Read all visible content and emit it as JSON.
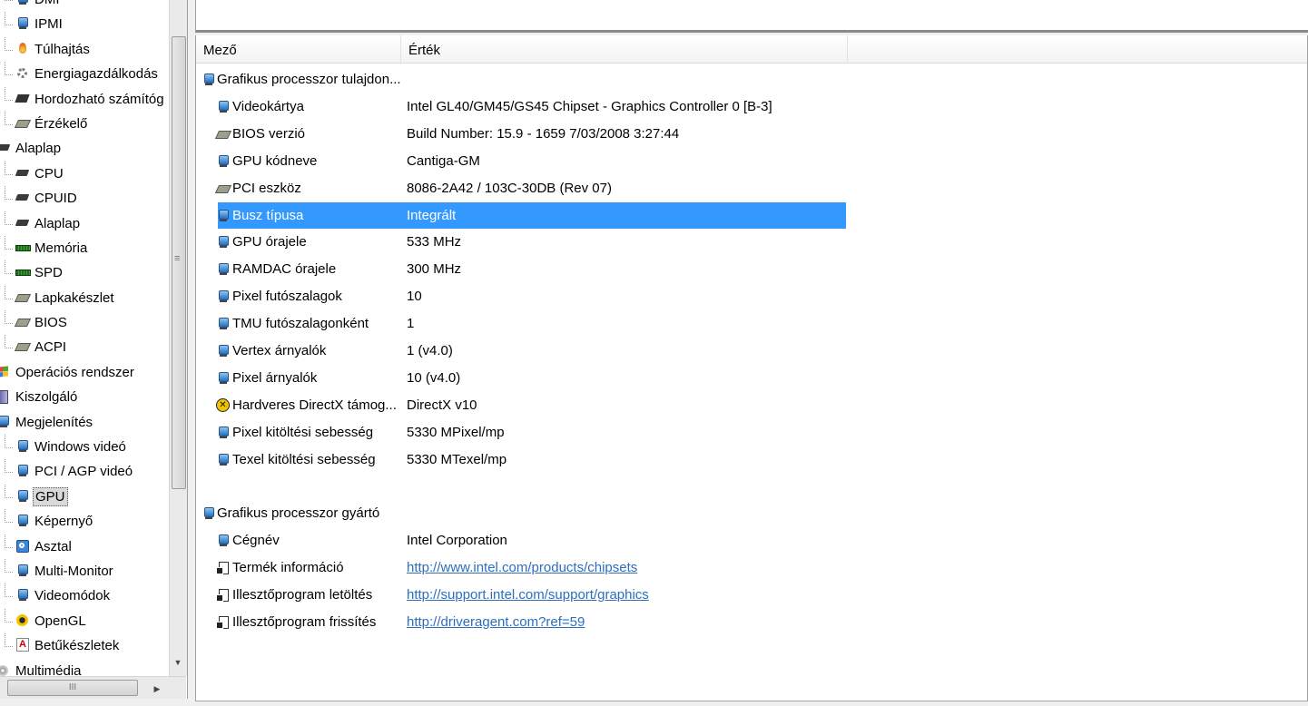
{
  "tree": {
    "items": [
      {
        "label": "DMI",
        "level": 2,
        "icon": "monitor-icon"
      },
      {
        "label": "IPMI",
        "level": 2,
        "icon": "monitor-icon"
      },
      {
        "label": "Túlhajtás",
        "level": 2,
        "icon": "fire-icon"
      },
      {
        "label": "Energiagazdálkodás",
        "level": 2,
        "icon": "gear-icon"
      },
      {
        "label": "Hordozható számítóg",
        "level": 2,
        "icon": "laptop-icon"
      },
      {
        "label": "Érzékelő",
        "level": 2,
        "icon": "card-icon"
      },
      {
        "label": "Alaplap",
        "level": 1,
        "icon": "chip-icon"
      },
      {
        "label": "CPU",
        "level": 2,
        "icon": "chip-icon"
      },
      {
        "label": "CPUID",
        "level": 2,
        "icon": "chip-icon"
      },
      {
        "label": "Alaplap",
        "level": 2,
        "icon": "chip-icon"
      },
      {
        "label": "Memória",
        "level": 2,
        "icon": "ram-icon"
      },
      {
        "label": "SPD",
        "level": 2,
        "icon": "ram-icon"
      },
      {
        "label": "Lapkakészlet",
        "level": 2,
        "icon": "card-icon"
      },
      {
        "label": "BIOS",
        "level": 2,
        "icon": "card-icon"
      },
      {
        "label": "ACPI",
        "level": 2,
        "icon": "card-icon"
      },
      {
        "label": "Operációs rendszer",
        "level": 1,
        "icon": "windows-icon"
      },
      {
        "label": "Kiszolgáló",
        "level": 1,
        "icon": "server-icon"
      },
      {
        "label": "Megjelenítés",
        "level": 1,
        "icon": "monitor-icon"
      },
      {
        "label": "Windows videó",
        "level": 2,
        "icon": "monitor-icon"
      },
      {
        "label": "PCI / AGP videó",
        "level": 2,
        "icon": "monitor-icon"
      },
      {
        "label": "GPU",
        "level": 2,
        "icon": "monitor-icon",
        "selected": true
      },
      {
        "label": "Képernyő",
        "level": 2,
        "icon": "monitor-icon"
      },
      {
        "label": "Asztal",
        "level": 2,
        "icon": "desktop-icon"
      },
      {
        "label": "Multi-Monitor",
        "level": 2,
        "icon": "monitor-icon"
      },
      {
        "label": "Videomódok",
        "level": 2,
        "icon": "monitor-icon"
      },
      {
        "label": "OpenGL",
        "level": 2,
        "icon": "opengl-icon"
      },
      {
        "label": "Betűkészletek",
        "level": 2,
        "icon": "font-icon"
      },
      {
        "label": "Multimédia",
        "level": 1,
        "icon": "multimedia-icon"
      }
    ]
  },
  "details": {
    "columns": {
      "field": "Mező",
      "value": "Érték"
    },
    "rows": [
      {
        "kind": "group",
        "field": "Grafikus processzor tulajdon...",
        "value": "",
        "icon": "monitor-icon"
      },
      {
        "kind": "item",
        "field": "Videokártya",
        "value": "Intel GL40/GM45/GS45 Chipset - Graphics Controller 0 [B-3]",
        "icon": "monitor-icon"
      },
      {
        "kind": "item",
        "field": "BIOS verzió",
        "value": "Build Number: 15.9 - 1659  7/03/2008  3:27:44",
        "icon": "card-icon"
      },
      {
        "kind": "item",
        "field": "GPU kódneve",
        "value": "Cantiga-GM",
        "icon": "monitor-icon"
      },
      {
        "kind": "item",
        "field": "PCI eszköz",
        "value": "8086-2A42 / 103C-30DB  (Rev 07)",
        "icon": "card-icon"
      },
      {
        "kind": "item",
        "field": "Busz típusa",
        "value": "Integrált",
        "icon": "monitor-icon",
        "selected": true
      },
      {
        "kind": "item",
        "field": "GPU órajele",
        "value": "533 MHz",
        "icon": "monitor-icon"
      },
      {
        "kind": "item",
        "field": "RAMDAC órajele",
        "value": "300 MHz",
        "icon": "monitor-icon"
      },
      {
        "kind": "item",
        "field": "Pixel futószalagok",
        "value": "10",
        "icon": "monitor-icon"
      },
      {
        "kind": "item",
        "field": "TMU futószalagonként",
        "value": "1",
        "icon": "monitor-icon"
      },
      {
        "kind": "item",
        "field": "Vertex árnyalók",
        "value": "1  (v4.0)",
        "icon": "monitor-icon"
      },
      {
        "kind": "item",
        "field": "Pixel árnyalók",
        "value": "10  (v4.0)",
        "icon": "monitor-icon"
      },
      {
        "kind": "item",
        "field": "Hardveres DirectX támog...",
        "value": "DirectX v10",
        "icon": "directx-icon"
      },
      {
        "kind": "item",
        "field": "Pixel kitöltési sebesség",
        "value": "5330 MPixel/mp",
        "icon": "monitor-icon"
      },
      {
        "kind": "item",
        "field": "Texel kitöltési sebesség",
        "value": "5330 MTexel/mp",
        "icon": "monitor-icon"
      },
      {
        "kind": "spacer"
      },
      {
        "kind": "group",
        "field": "Grafikus processzor gyártó",
        "value": "",
        "icon": "monitor-icon"
      },
      {
        "kind": "item",
        "field": "Cégnév",
        "value": "Intel Corporation",
        "icon": "monitor-icon"
      },
      {
        "kind": "item",
        "field": "Termék információ",
        "value": "http://www.intel.com/products/chipsets",
        "icon": "link-doc-icon",
        "link": true
      },
      {
        "kind": "item",
        "field": "Illesztőprogram letöltés",
        "value": "http://support.intel.com/support/graphics",
        "icon": "link-doc-icon",
        "link": true
      },
      {
        "kind": "item",
        "field": "Illesztőprogram frissítés",
        "value": "http://driveragent.com?ref=59",
        "icon": "link-doc-icon",
        "link": true
      }
    ]
  },
  "scrollbar": {
    "thumb_grip": "≡",
    "h_grip": "III",
    "down_arrow": "▼",
    "right_arrow": "▶"
  },
  "colors": {
    "selection": "#3399ff",
    "link": "#2e6ebd",
    "tree_selection": "#d9d9d9"
  }
}
